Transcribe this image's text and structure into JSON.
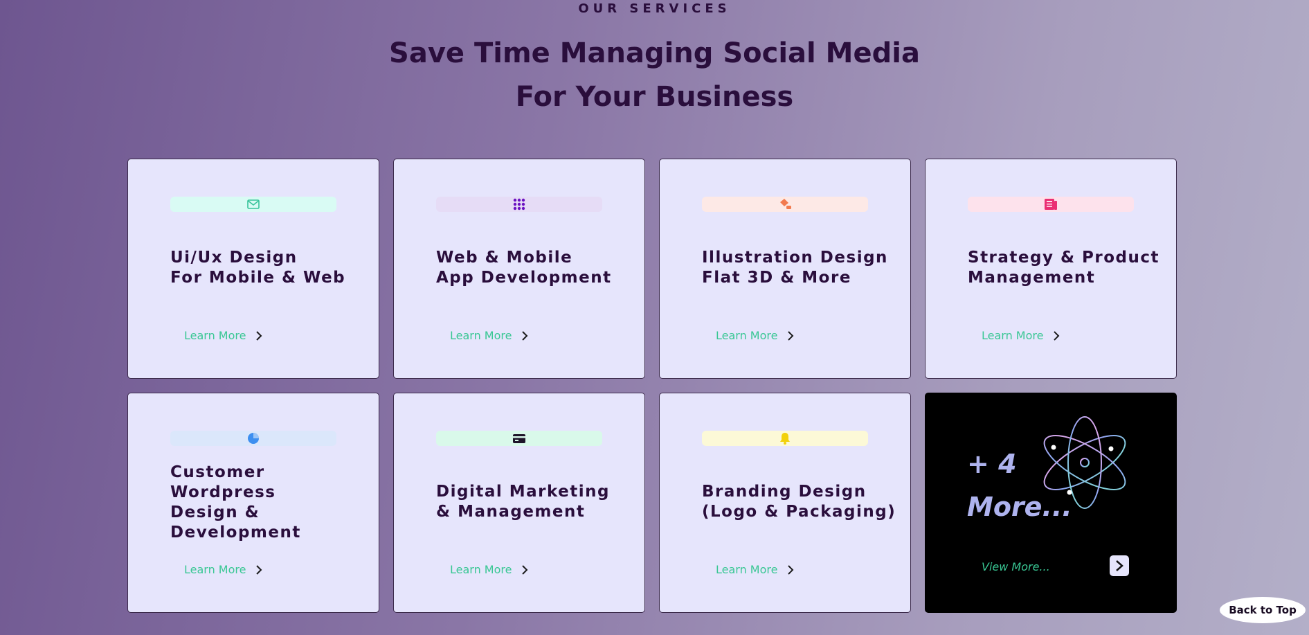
{
  "section": {
    "eyebrow": "OUR SERVICES",
    "headline_line1": "Save Time Managing Social Media",
    "headline_line2": "For Your Business"
  },
  "cards": [
    {
      "title_lines": [
        "Ui/Ux Design",
        "For Mobile & Web"
      ],
      "icon": "mail-icon",
      "pill_color": "#d9fbf4",
      "icon_color": "#37c39a",
      "link": "Learn More"
    },
    {
      "title_lines": [
        "Web & Mobile",
        "App Development"
      ],
      "icon": "grid-dots-icon",
      "pill_color": "#e6dcf6",
      "icon_color": "#6b12c2",
      "link": "Learn More"
    },
    {
      "title_lines": [
        "Illustration Design",
        "Flat 3D & More"
      ],
      "icon": "brush-icon",
      "pill_color": "#fde9e6",
      "icon_color": "#f27a4f",
      "link": "Learn More"
    },
    {
      "title_lines": [
        "Strategy & Product",
        "Management"
      ],
      "icon": "newspaper-icon",
      "pill_color": "#fde2ec",
      "icon_color": "#ea2f73",
      "link": "Learn More"
    },
    {
      "title_lines": [
        "Customer",
        "Wordpress",
        "Design &",
        "Development"
      ],
      "icon": "pie-chart-icon",
      "pill_color": "#dbe7fb",
      "icon_color": "#3d8ff0",
      "link": "Learn More"
    },
    {
      "title_lines": [
        "Digital Marketing",
        "& Management"
      ],
      "icon": "credit-card-icon",
      "pill_color": "#d9f9ea",
      "icon_color": "#1d1429",
      "link": "Learn More"
    },
    {
      "title_lines": [
        "Branding Design",
        "(Logo & Packaging)"
      ],
      "icon": "bell-icon",
      "pill_color": "#fcf9d7",
      "icon_color": "#f2d10a",
      "link": "Learn More"
    }
  ],
  "more_card": {
    "count": "+ 4",
    "label": "More...",
    "link": "View More..."
  },
  "back_to_top": "Back to Top"
}
